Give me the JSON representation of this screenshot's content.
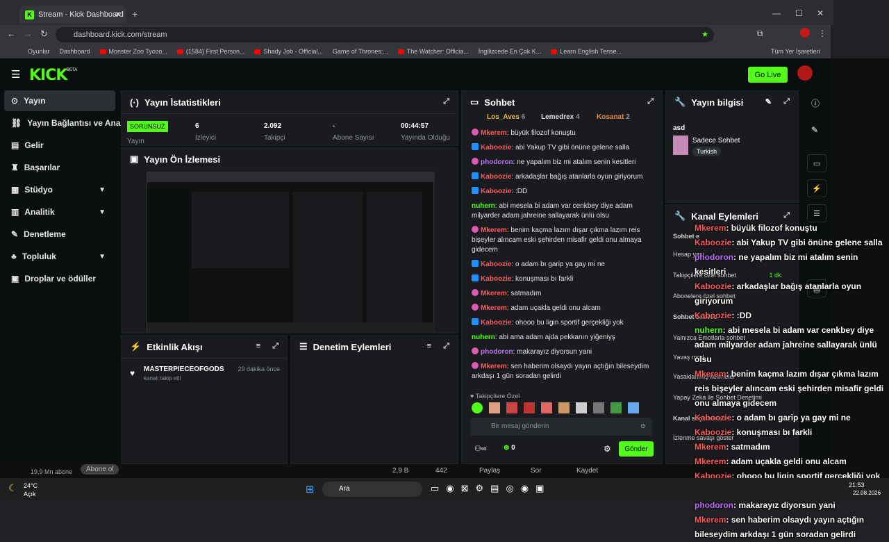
{
  "browser": {
    "tab_title": "Stream - Kick Dashboard",
    "url": "dashboard.kick.com/stream",
    "bookmarks": [
      "Oyunlar",
      "Dashboard",
      "Monster Zoo Tycoo...",
      "(1584) First Person...",
      "Shady Job - Official...",
      "Game of Thrones:...",
      "The Watcher: Officia...",
      "İngilizcede En Çok K...",
      "Learn English Tense..."
    ],
    "all_bookmarks": "Tüm Yer İşaretleri"
  },
  "app": {
    "logo": "KICK",
    "beta": "BETA",
    "go_live": "Go Live"
  },
  "sidenav": [
    {
      "label": "Yayın",
      "active": true
    },
    {
      "label": "Yayın Bağlantısı ve Anahtarı"
    },
    {
      "label": "Gelir"
    },
    {
      "label": "Başarılar"
    },
    {
      "label": "Stüdyo",
      "chev": true
    },
    {
      "label": "Analitik",
      "chev": true
    },
    {
      "label": "Denetleme"
    },
    {
      "label": "Topluluk",
      "chev": true
    },
    {
      "label": "Droplar ve ödüller"
    }
  ],
  "stats": {
    "title": "Yayın İstatistikleri",
    "status": "SORUNSUZ",
    "status_label": "Yayın",
    "items": [
      {
        "value": "6",
        "label": "İzleyici"
      },
      {
        "value": "2.092",
        "label": "Takipçi"
      },
      {
        "value": "-",
        "label": "Abone Sayısı"
      },
      {
        "value": "00:44:57",
        "label": "Yayında Olduğu"
      }
    ]
  },
  "preview": {
    "title": "Yayın Ön İzlemesi"
  },
  "activity": {
    "title": "Etkinlik Akışı",
    "user": "MASTERPIECEOFGODS",
    "action": "kanalı takip etti",
    "time": "29 dakika önce"
  },
  "moderation": {
    "title": "Denetim Eylemleri"
  },
  "chat": {
    "title": "Sohbet",
    "top": [
      {
        "rank": "1",
        "name": "Los_Aves",
        "count": "6"
      },
      {
        "rank": "2",
        "name": "Lemedrex",
        "count": "4"
      },
      {
        "rank": "3",
        "name": "Kosanat",
        "count": "2"
      }
    ],
    "messages": [
      {
        "user": "Mkerem",
        "text": ": büyük filozof konuştu",
        "color": "#ff5a5a",
        "badge": "b3"
      },
      {
        "user": "Kaboozie",
        "text": ": abi Yakup TV gibi önüne gelene salla",
        "color": "#ff5a5a",
        "badge": "b2"
      },
      {
        "user": "phodoron",
        "text": ": ne yapalım biz mi atalım senin kesitleri",
        "color": "#c36bff",
        "badge": "b3"
      },
      {
        "user": "Kaboozie",
        "text": ": arkadaşlar bağış atanlarla oyun giriyorum",
        "color": "#ff5a5a",
        "badge": "b2"
      },
      {
        "user": "Kaboozie",
        "text": ": :DD",
        "color": "#ff5a5a",
        "badge": "b2"
      },
      {
        "user": "nuhern",
        "text": ": abi mesela bi adam var cenkbey diye adam milyarder adam jahreine sallayarak ünlü olsu",
        "color": "#53fc18",
        "badge": ""
      },
      {
        "user": "Mkerem",
        "text": ": benim kaçma lazım dışar çıkma lazım reis bişeyler alıncam eski şehirden misafir geldi onu almaya gidecem",
        "color": "#ff5a5a",
        "badge": "b3"
      },
      {
        "user": "Kaboozie",
        "text": ": o adam bı garip ya gay mi ne",
        "color": "#ff5a5a",
        "badge": "b2"
      },
      {
        "user": "Kaboozie",
        "text": ": konuşması bı farkli",
        "color": "#ff5a5a",
        "badge": "b2"
      },
      {
        "user": "Mkerem",
        "text": ": satmadım",
        "color": "#ff5a5a",
        "badge": "b3"
      },
      {
        "user": "Mkerem",
        "text": ": adam uçakla geldi onu alcam",
        "color": "#ff5a5a",
        "badge": "b3"
      },
      {
        "user": "Kaboozie",
        "text": ": ohooo bu ligin sportif gerçekliği yok",
        "color": "#ff5a5a",
        "badge": "b2"
      },
      {
        "user": "nuhern",
        "text": ": abi ama adam ajda pekkanın yiğeniyş",
        "color": "#53fc18",
        "badge": ""
      },
      {
        "user": "phodoron",
        "text": ": makarayız diyorsun yani",
        "color": "#c36bff",
        "badge": "b3"
      },
      {
        "user": "Mkerem",
        "text": ": sen haberim olsaydı yayın açtığın bileseydim arkdaşı 1 gün soradan gelirdi",
        "color": "#ff5a5a",
        "badge": "b3"
      }
    ],
    "special": "Takipçilere Özel",
    "placeholder": "Bir mesaj gönderin",
    "points": "0",
    "send": "Gönder"
  },
  "info": {
    "title": "Yayın bilgisi",
    "stream_title": "asd",
    "category": "Sadece Sohbet",
    "language": "Turkish"
  },
  "channel": {
    "title": "Kanal Eylemleri",
    "rows": [
      "Sohbet e",
      "Hesap yaşı",
      "Takipçilere özel sohbet",
      "Abonelere özel sohbet",
      "Sohbet sadece",
      "Yalnızca Emotlarla sohbet",
      "Yavaş mod",
      "Yasaklanmış kelimeler",
      "Yapay Zeka ile Sohbet Denetimi",
      "Kanal seçenekleri",
      "İzlenme savaşı göster"
    ],
    "follow_time": "1 dk."
  },
  "overlay": [
    {
      "user": "Mkerem",
      "text": ": büyük filozof konuştu",
      "cls": "n"
    },
    {
      "user": "Kaboozie",
      "text": ": abi Yakup TV gibi önüne gelene salla",
      "cls": "n"
    },
    {
      "user": "phodoron",
      "text": ": ne yapalım biz mi atalım senin kesitleri",
      "cls": "n p"
    },
    {
      "user": "Kaboozie",
      "text": ": arkadaşlar bağış atanlarla oyun giriyorum",
      "cls": "n"
    },
    {
      "user": "Kaboozie",
      "text": ": :DD",
      "cls": "n"
    },
    {
      "user": "nuhern",
      "text": ": abi mesela bi adam var cenkbey diye adam milyarder adam jahreine sallayarak ünlü olsu",
      "cls": "n g"
    },
    {
      "user": "Mkerem",
      "text": ": benim kaçma lazım dışar çıkma lazım reis bişeyler alıncam eski şehirden misafir geldi onu almaya gidecem",
      "cls": "n"
    },
    {
      "user": "Kaboozie",
      "text": ": o adam bı garip ya gay mi ne",
      "cls": "n"
    },
    {
      "user": "Kaboozie",
      "text": ": konuşması bı farkli",
      "cls": "n"
    },
    {
      "user": "Mkerem",
      "text": ": satmadım",
      "cls": "n"
    },
    {
      "user": "Mkerem",
      "text": ": adam uçakla geldi onu alcam",
      "cls": "n"
    },
    {
      "user": "Kaboozie",
      "text": ": ohooo bu ligin sportif gerçekliği yok",
      "cls": "n"
    },
    {
      "user": "nuhern",
      "text": ": abi ama adam ajda pekkanın yiğeniyş",
      "cls": "n g"
    },
    {
      "user": "phodoron",
      "text": ": makarayız diyorsun yani",
      "cls": "n p"
    },
    {
      "user": "Mkerem",
      "text": ": sen haberim olsaydı yayın açtığın bileseydim arkdaşı 1 gün soradan gelirdi",
      "cls": "n"
    }
  ],
  "youtube": {
    "subs": "19,9 Mn abone",
    "subscribe": "Abone ol",
    "likes": "2,9 B",
    "dislikes": "442",
    "share": "Paylaş",
    "ask": "Sor",
    "save": "Kaydet"
  },
  "taskbar": {
    "temp": "24°C",
    "weather": "Açık",
    "search": "Ara",
    "time": "21:53",
    "date": "22.08.2026"
  }
}
